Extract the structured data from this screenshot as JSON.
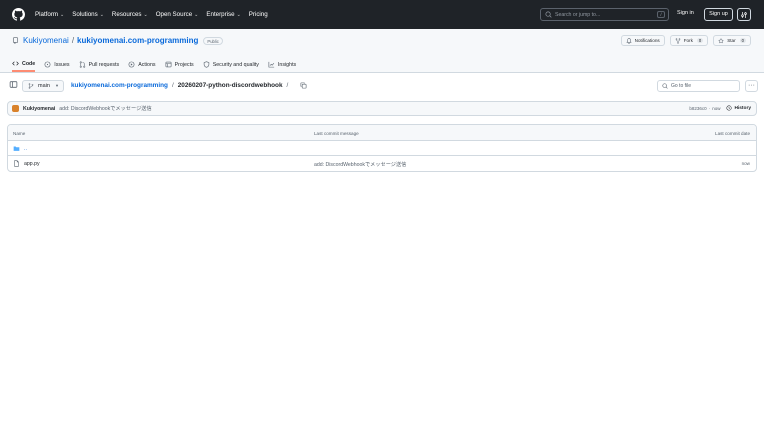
{
  "header": {
    "nav": [
      {
        "label": "Platform",
        "has_dropdown": true
      },
      {
        "label": "Solutions",
        "has_dropdown": true
      },
      {
        "label": "Resources",
        "has_dropdown": true
      },
      {
        "label": "Open Source",
        "has_dropdown": true
      },
      {
        "label": "Enterprise",
        "has_dropdown": true
      },
      {
        "label": "Pricing",
        "has_dropdown": false
      }
    ],
    "search_placeholder": "Search or jump to...",
    "search_shortcut": "/",
    "sign_in": "Sign in",
    "sign_up": "Sign up"
  },
  "repo": {
    "owner": "Kukiyomenai",
    "separator": "/",
    "name": "kukiyomenai.com-programming",
    "visibility": "Public",
    "actions": {
      "notifications": "Notifications",
      "fork_label": "Fork",
      "fork_count": "0",
      "star_label": "Star",
      "star_count": "0"
    },
    "tabs": [
      {
        "label": "Code",
        "icon": "code-icon",
        "active": true
      },
      {
        "label": "Issues",
        "icon": "issue-icon",
        "active": false
      },
      {
        "label": "Pull requests",
        "icon": "pull-request-icon",
        "active": false
      },
      {
        "label": "Actions",
        "icon": "play-icon",
        "active": false
      },
      {
        "label": "Projects",
        "icon": "table-icon",
        "active": false
      },
      {
        "label": "Security and quality",
        "icon": "shield-icon",
        "active": false
      },
      {
        "label": "Insights",
        "icon": "graph-icon",
        "active": false
      }
    ]
  },
  "path": {
    "branch": "main",
    "root": "kukiyomenai.com-programming",
    "separator": "/",
    "current": "20260207-python-discordwebhook",
    "trailing_separator": "/",
    "go_to_file_placeholder": "Go to file",
    "more": "···"
  },
  "latest_commit": {
    "author": "Kukiyomenai",
    "message": "add: DiscordWebhookでメッセージ送信",
    "hash": "b8236c0",
    "separator": "·",
    "time": "now",
    "history": "History"
  },
  "files": {
    "columns": {
      "name": "Name",
      "message": "Last commit message",
      "date": "Last commit date"
    },
    "parent": "..",
    "rows": [
      {
        "name": "app.py",
        "type": "file",
        "message": "add: DiscordWebhookでメッセージ送信",
        "date": "now"
      }
    ]
  },
  "colors": {
    "header_bg": "#1f2328",
    "link": "#0969da",
    "active_tab_underline": "#fd8c73",
    "border": "#d1d9e0",
    "subtle_bg": "#f6f8fa",
    "folder": "#54aeff"
  }
}
